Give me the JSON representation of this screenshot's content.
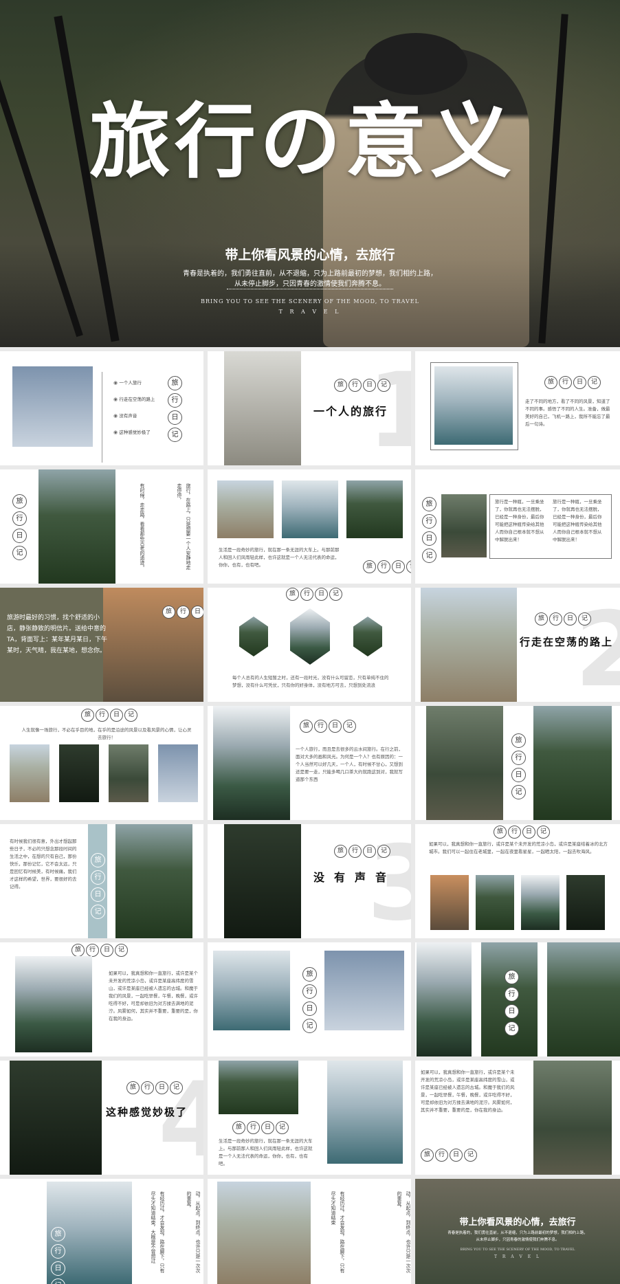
{
  "hero": {
    "title": "旅行の意义",
    "subtitle": "带上你看风景的心情，去旅行",
    "line1": "青春是执着的，我们勇往直前，从不退缩，只为上路前最初的梦想，我们相约上路，",
    "line2": "从未停止脚步，只因青春的激情使我们奔腾不息。",
    "en1": "BRING YOU TO SEE THE SCENERY OF THE MOOD, TO TRAVEL",
    "en2": "T R A V E L"
  },
  "stamp": [
    "旅",
    "行",
    "日",
    "记"
  ],
  "slides": {
    "s2_list": [
      "一个人旅行",
      "行走在空荡的路上",
      "没有声音",
      "这种感觉妙极了"
    ],
    "s3_title": "一个人的旅行",
    "s3_num": "1",
    "s4_text": "走了不同的地方，看了不同的风景，知道了不同的事。感悟了不同的人生。准备，做最美好的自己，飞机一路上，我所不能忘了最后一句诗。",
    "s5_vtext": [
      "旅行，在路上，只是想要一个人安静地走走停停，",
      "有时候，走走路，看看那些古老的遗迹。"
    ],
    "s6_text": "生活是一段奇妙的旅行，就在那一条无涯的大车上。与那前那人和回人们风雨轻此样，也许这就是一个人无法代表的命运，你你，也有，也有吧。",
    "s7_col1": "旅行是一种瓶，一旦乘坐了，你就再也无法摆脱，已经是一种身份，最后你可能把这种瓶传染给其他人而你自己根本就不想从中解脱出来！",
    "s7_col2": "旅行是一种瓶，一旦乘坐了，你就再也无法摆脱，已经是一种身份，最后你可能把这种瓶传染给其他人而你自己根本就不想从中解脱出来！",
    "s8_text": "旅游时最好的习惯，找个舒适的小店，静张静致的明信片。送给中意的TA，背面写上：某年某月某日，下午某时，天气晴，我在某地，想念你。",
    "s9_text": "每个人总有的人生短暂之时，还有一段时光，没有什么可留恋，只有单纯不住的梦想，没有什么可凭仗，只有你的好身体，没有地方可去，只想到处流浪",
    "s10_title": "行走在空荡的路上",
    "s10_num": "2",
    "s11_text": "人生就像一场旅行，不必在乎目的地，在乎的是沿途的风景以及看风景的心情，让心灵去旅行！",
    "s12_text": "一个人旅行，而且是去很多的云水间旅行。在行之前，面对大多的画和风光。为何是一个人？也有原因的：一个人当然可以好几天，一个人，有时候不甘心，又想到还是要一走，只能多喝几口茶大约就跑这到对，我就写道那个东西",
    "s14_text": "有时候我们很有意，外出才想起那些日子，不必的只想念那段时间的生活之中，在想的只有自己，那份快乐，那份记忆，它不会太远，只是回忆有时候美，有时候痛，我们才这样的希望，世界，要很好的去记得。",
    "s15_title": "没有声音",
    "s15_num": "3",
    "s16_text": "如果可以，我真想和你一直旅行，或许是某个未开发的荒凉小岛，或许是某座结着冰的北方城市。我们可以一起住在老城里，一起在夜里看星星，一起晒太阳，一起去吹海风。",
    "s17_text": "如果可以，我真想和你一直旅行，或许是某个未开发的荒凉小岛，或许是某座高纬度的雪山，或许是某座已经被人遗忘的古城。和魔于我们的风景，一起吃早餐，午餐，晚餐，或许吃得不好，可是却依旧为对方揉去满地的泥泞。风雾如何，其实并不重要，重要的是，你在我的身边。",
    "s20_title": "这种感觉妙极了",
    "s20_num": "4",
    "s21_text": "生活是一段奇妙的旅行，就在那一条无涯的大车上。与那前那人和回人们风雨轻此样，也许这就是一个人无法代表的命运，你你，也有，也有吧。",
    "s22_text": "如果可以，我真想和你一直旅行，或许是某个未开发的荒凉小岛，或许是某座高纬度的雪山，或许是某座已经被人遗忘的古城。和魔于我们的风景，一起吃早餐，午餐，晚餐，或许吃得不好，可是却依旧为对方揉去满地的泥泞。风雾如何，其实并不重要，重要的是，你在我的身边。",
    "s23_vtext": [
      "一个人，一条路，人在途中，心随景动，从起点，到终点，也许只是一次次的重复，",
      "有经历过，才会发现，路在脚下，只有尽头才知道结束，大概是不曾想过"
    ],
    "s25_vtext": [
      "一个人，一条路，人在途中，心随景动，从起点，到终点，也许只是一次次的重复，",
      "有经历过，才会发现，路在脚下，只有尽头才知道结束"
    ],
    "s26_title": "带上你看风景的心情，去旅行",
    "s26_line1": "青春是执着的，我们勇往直前，从不退缩，只为上路前最初的梦想，我们相约上路，",
    "s26_line2": "从未停止脚步，只因青春的激情使我们奔腾不息。",
    "s26_en1": "BRING YOU TO SEE THE SCENERY OF THE MOOD, TO TRAVEL",
    "s26_en2": "T R A V E L"
  }
}
